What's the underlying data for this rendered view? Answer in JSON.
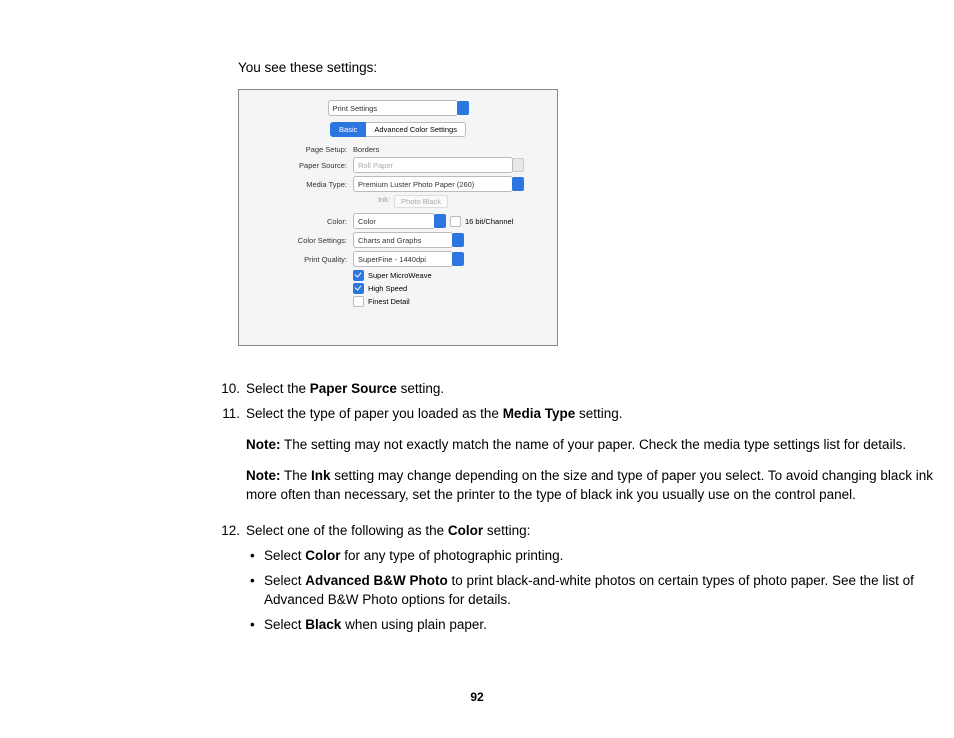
{
  "intro": "You see these settings:",
  "dialog": {
    "main_dropdown": "Print Settings",
    "tab_basic": "Basic",
    "tab_adv": "Advanced Color Settings",
    "rows": {
      "page_setup_label": "Page Setup:",
      "page_setup_value": "Borders",
      "paper_source_label": "Paper Source:",
      "paper_source_value": "Roll Paper",
      "media_type_label": "Media Type:",
      "media_type_value": "Premium Luster Photo Paper (260)",
      "ink_label": "Ink:",
      "ink_value": "Photo Black",
      "color_label": "Color:",
      "color_value": "Color",
      "sixteen_bit": "16 bit/Channel",
      "color_settings_label": "Color Settings:",
      "color_settings_value": "Charts and Graphs",
      "print_quality_label": "Print Quality:",
      "print_quality_value": "SuperFine - 1440dpi",
      "chk1": "Super MicroWeave",
      "chk2": "High Speed",
      "chk3": "Finest Detail"
    }
  },
  "step10_num": "10.",
  "step10_a": "Select the ",
  "step10_b": "Paper Source",
  "step10_c": " setting.",
  "step11_num": "11.",
  "step11_a": "Select the type of paper you loaded as the ",
  "step11_b": "Media Type",
  "step11_c": " setting.",
  "note1_a": "Note:",
  "note1_b": " The setting may not exactly match the name of your paper. Check the media type settings list for details.",
  "note2_a": "Note:",
  "note2_b": " The ",
  "note2_c": "Ink",
  "note2_d": " setting may change depending on the size and type of paper you select. To avoid changing black ink more often than necessary, set the printer to the type of black ink you usually use on the control panel.",
  "step12_num": "12.",
  "step12_a": "Select one of the following as the ",
  "step12_b": "Color",
  "step12_c": " setting:",
  "b1_a": "Select ",
  "b1_b": "Color",
  "b1_c": " for any type of photographic printing.",
  "b2_a": "Select ",
  "b2_b": "Advanced B&W Photo",
  "b2_c": " to print black-and-white photos on certain types of photo paper. See the list of Advanced B&W Photo options for details.",
  "b3_a": "Select ",
  "b3_b": "Black",
  "b3_c": " when using plain paper.",
  "page_number": "92"
}
